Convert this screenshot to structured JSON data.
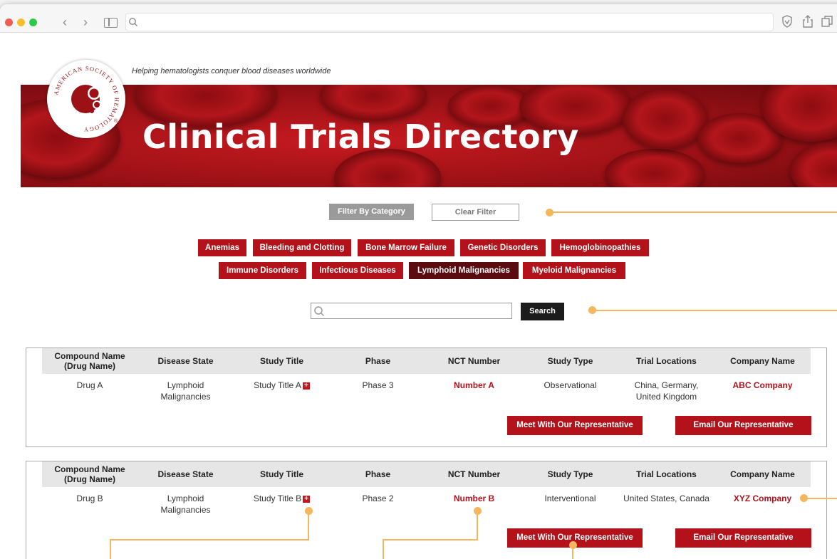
{
  "tagline": "Helping hematologists conquer blood diseases worldwide",
  "banner_title": "Clinical Trials Directory",
  "logo": {
    "ring_text": "AMERICAN SOCIETY OF HEMATOLOGY",
    "registered": "®"
  },
  "filter": {
    "filter_label": "Filter By Category",
    "clear_label": "Clear Filter"
  },
  "categories": [
    "Anemias",
    "Bleeding and Clotting",
    "Bone Marrow Failure",
    "Genetic Disorders",
    "Hemoglobinopathies",
    "Immune Disorders",
    "Infectious Diseases",
    "Lymphoid Malignancies",
    "Myeloid Malignancies"
  ],
  "active_category": "Lymphoid Malignancies",
  "search": {
    "value": "",
    "placeholder": "",
    "button_label": "Search"
  },
  "columns": [
    "Compound Name (Drug Name)",
    "Disease State",
    "Study Title",
    "Phase",
    "NCT Number",
    "Study Type",
    "Trial Locations",
    "Company Name"
  ],
  "trials": [
    {
      "compound": "Drug A",
      "disease": "Lymphoid Malignancies",
      "study_title": "Study Title A",
      "phase": "Phase 3",
      "nct": "Number A",
      "study_type": "Observational",
      "locations": "China, Germany, United Kingdom",
      "company": "ABC Company"
    },
    {
      "compound": "Drug B",
      "disease": "Lymphoid Malignancies",
      "study_title": "Study Title B",
      "phase": "Phase 2",
      "nct": "Number B",
      "study_type": "Interventional",
      "locations": "United States, Canada",
      "company": "XYZ Company"
    }
  ],
  "actions": {
    "meet_label": "Meet With Our Representative",
    "email_label": "Email Our Representative"
  },
  "colors": {
    "brand_red": "#b3121a",
    "active_category": "#5b0c10",
    "callout": "#f5b75e"
  }
}
